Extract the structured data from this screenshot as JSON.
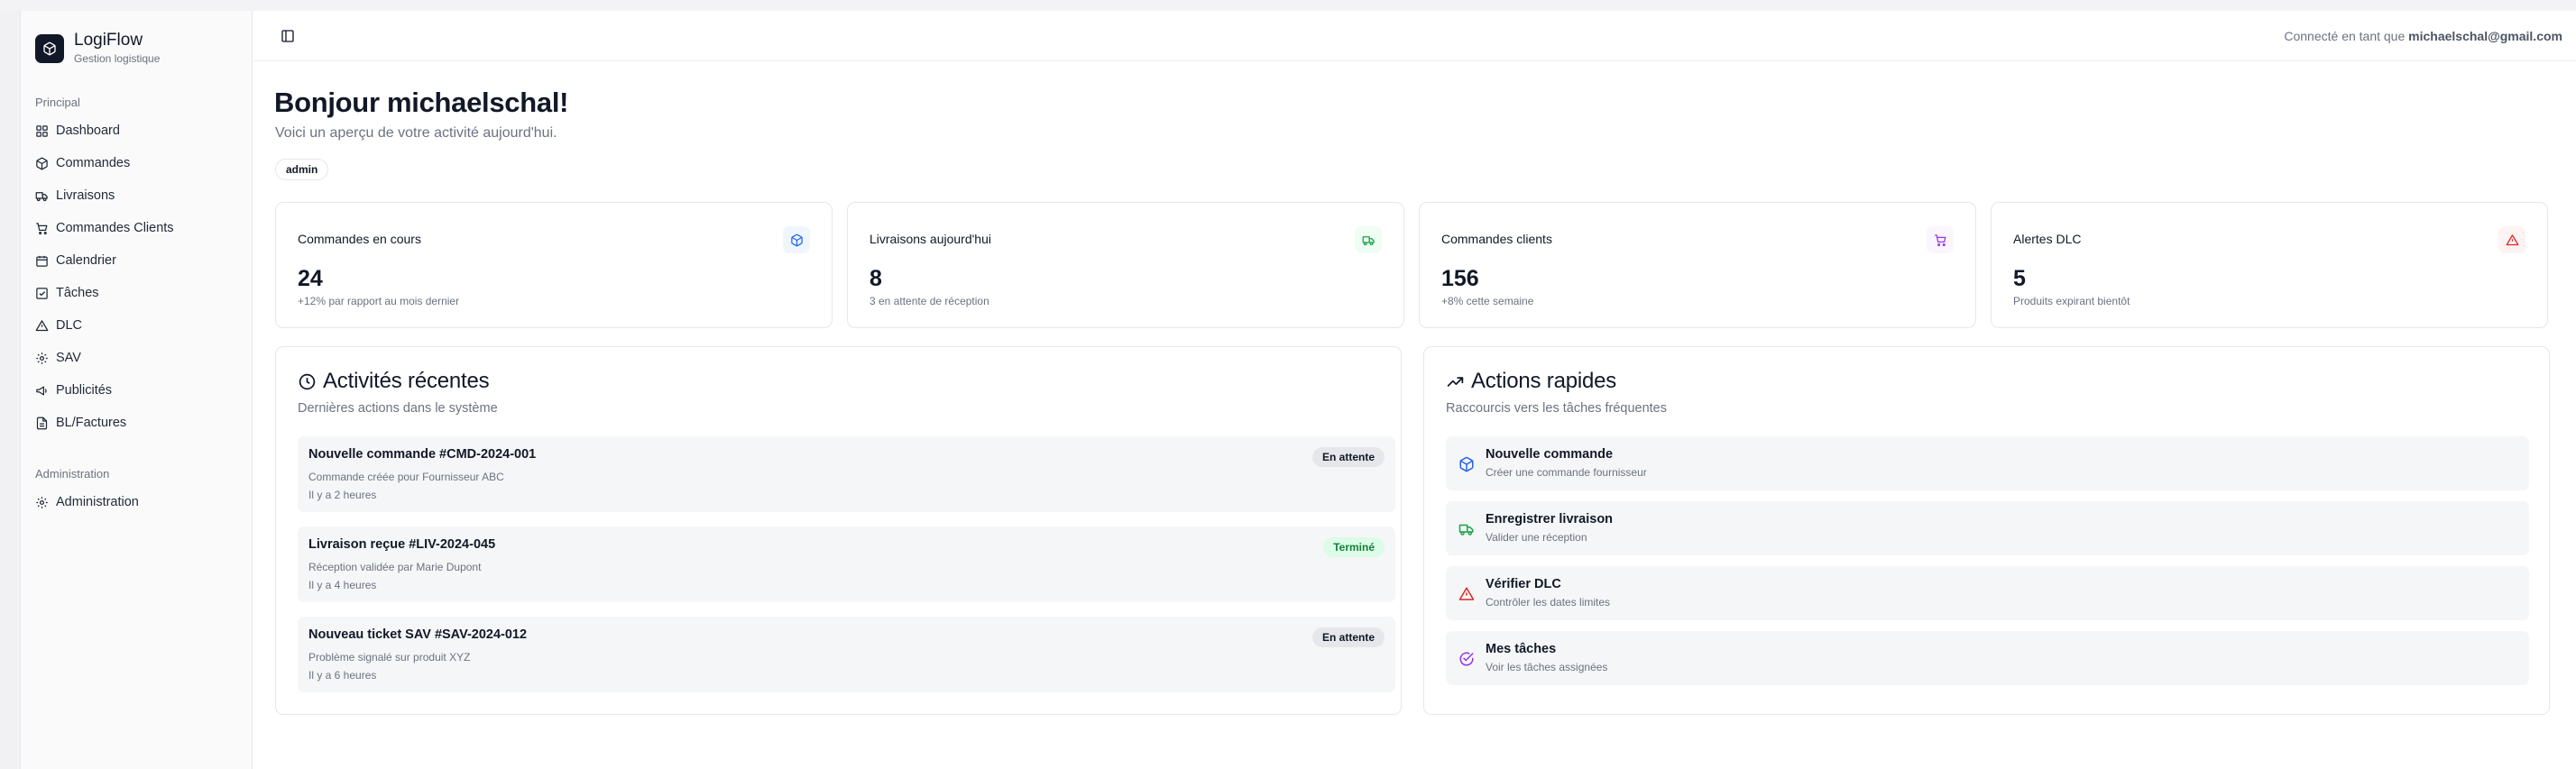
{
  "brand": {
    "name": "LogiFlow",
    "subtitle": "Gestion logistique"
  },
  "sidebar": {
    "group_main": "Principal",
    "items": [
      {
        "label": "Dashboard",
        "icon": "dashboard-icon"
      },
      {
        "label": "Commandes",
        "icon": "package-icon"
      },
      {
        "label": "Livraisons",
        "icon": "truck-icon"
      },
      {
        "label": "Commandes Clients",
        "icon": "cart-icon"
      },
      {
        "label": "Calendrier",
        "icon": "calendar-icon"
      },
      {
        "label": "Tâches",
        "icon": "checkbox-icon"
      },
      {
        "label": "DLC",
        "icon": "alert-triangle-icon"
      },
      {
        "label": "SAV",
        "icon": "gear-icon"
      },
      {
        "label": "Publicités",
        "icon": "megaphone-icon"
      },
      {
        "label": "BL/Factures",
        "icon": "file-icon"
      }
    ],
    "group_admin": "Administration",
    "admin_items": [
      {
        "label": "Administration",
        "icon": "gear-icon"
      }
    ]
  },
  "header": {
    "login_prefix": "Connecté en tant que",
    "login_email": "michaelschal@gmail.com"
  },
  "welcome": {
    "title": "Bonjour michaelschal!",
    "subtitle": "Voici un aperçu de votre activité aujourd'hui.",
    "role": "admin"
  },
  "stats": [
    {
      "title": "Commandes en cours",
      "value": "24",
      "note": "+12% par rapport au mois dernier",
      "icon": "package-icon",
      "color": "#2563eb",
      "bg": "#eff6ff"
    },
    {
      "title": "Livraisons aujourd'hui",
      "value": "8",
      "note": "3 en attente de réception",
      "icon": "truck-icon",
      "color": "#16a34a",
      "bg": "#f0fdf4"
    },
    {
      "title": "Commandes clients",
      "value": "156",
      "note": "+8% cette semaine",
      "icon": "cart-icon",
      "color": "#9333ea",
      "bg": "#faf5ff"
    },
    {
      "title": "Alertes DLC",
      "value": "5",
      "note": "Produits expirant bientôt",
      "icon": "alert-triangle-icon",
      "color": "#dc2626",
      "bg": "#fef2f2"
    }
  ],
  "activities": {
    "title": "Activités récentes",
    "subtitle": "Dernières actions dans le système",
    "items": [
      {
        "title": "Nouvelle commande #CMD-2024-001",
        "desc": "Commande créée pour Fournisseur ABC",
        "time": "Il y a 2 heures",
        "status": "En attente",
        "status_color": "#111827",
        "status_bg": "#e5e7eb"
      },
      {
        "title": "Livraison reçue #LIV-2024-045",
        "desc": "Réception validée par Marie Dupont",
        "time": "Il y a 4 heures",
        "status": "Terminé",
        "status_color": "#15803d",
        "status_bg": "#dcfce7"
      },
      {
        "title": "Nouveau ticket SAV #SAV-2024-012",
        "desc": "Problème signalé sur produit XYZ",
        "time": "Il y a 6 heures",
        "status": "En attente",
        "status_color": "#111827",
        "status_bg": "#e5e7eb"
      }
    ]
  },
  "quick_actions": {
    "title": "Actions rapides",
    "subtitle": "Raccourcis vers les tâches fréquentes",
    "items": [
      {
        "title": "Nouvelle commande",
        "desc": "Créer une commande fournisseur",
        "icon": "package-icon",
        "color": "#2563eb"
      },
      {
        "title": "Enregistrer livraison",
        "desc": "Valider une réception",
        "icon": "truck-icon",
        "color": "#16a34a"
      },
      {
        "title": "Vérifier DLC",
        "desc": "Contrôler les dates limites",
        "icon": "alert-triangle-icon",
        "color": "#dc2626"
      },
      {
        "title": "Mes tâches",
        "desc": "Voir les tâches assignées",
        "icon": "check-circle-icon",
        "color": "#9333ea"
      }
    ]
  }
}
